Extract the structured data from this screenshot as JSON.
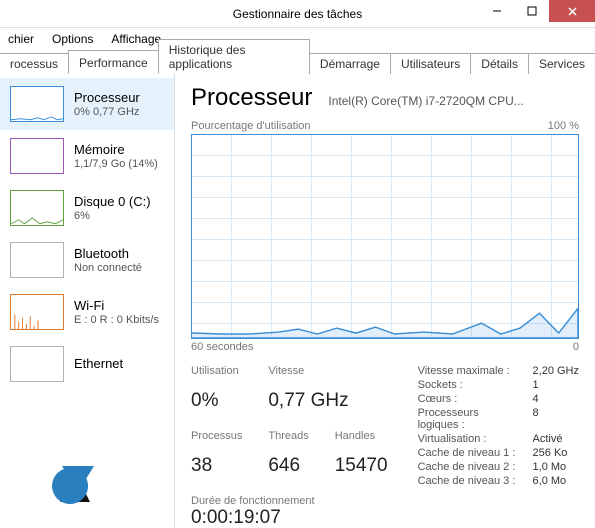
{
  "window": {
    "title": "Gestionnaire des tâches"
  },
  "menu": {
    "file": "chier",
    "options": "Options",
    "view": "Affichage"
  },
  "tabs": {
    "processes": "rocessus",
    "performance": "Performance",
    "apphistory": "Historique des applications",
    "startup": "Démarrage",
    "users": "Utilisateurs",
    "details": "Détails",
    "services": "Services"
  },
  "sidebar": {
    "cpu": {
      "title": "Processeur",
      "sub": "0%  0,77 GHz"
    },
    "mem": {
      "title": "Mémoire",
      "sub": "1,1/7,9 Go (14%)"
    },
    "disk": {
      "title": "Disque 0 (C:)",
      "sub": "6%"
    },
    "bt": {
      "title": "Bluetooth",
      "sub": "Non connecté"
    },
    "wifi": {
      "title": "Wi-Fi",
      "sub": "E : 0 R : 0 Kbits/s"
    },
    "eth": {
      "title": "Ethernet",
      "sub": ""
    }
  },
  "main": {
    "title": "Processeur",
    "subtitle": "Intel(R) Core(TM) i7-2720QM CPU...",
    "chart_label": "Pourcentage d'utilisation",
    "chart_max": "100 %",
    "chart_xmin": "60 secondes",
    "chart_xmax": "0",
    "stats": {
      "util_label": "Utilisation",
      "util": "0%",
      "speed_label": "Vitesse",
      "speed": "0,77 GHz",
      "proc_label": "Processus",
      "proc": "38",
      "threads_label": "Threads",
      "threads": "646",
      "handles_label": "Handles",
      "handles": "15470",
      "uptime_label": "Durée de fonctionnement",
      "uptime": "0:00:19:07"
    },
    "details": {
      "maxspeed_label": "Vitesse maximale :",
      "maxspeed": "2,20 GHz",
      "sockets_label": "Sockets :",
      "sockets": "1",
      "cores_label": "Cœurs :",
      "cores": "4",
      "logical_label": "Processeurs logiques :",
      "logical": "8",
      "virt_label": "Virtualisation :",
      "virt": "Activé",
      "l1_label": "Cache de niveau 1 :",
      "l1": "256 Ko",
      "l2_label": "Cache de niveau 2 :",
      "l2": "1,0 Mo",
      "l3_label": "Cache de niveau 3 :",
      "l3": "6,0 Mo"
    }
  },
  "chart_data": {
    "type": "line",
    "title": "Pourcentage d'utilisation",
    "xlabel": "60 secondes → 0",
    "ylabel": "%",
    "ylim": [
      0,
      100
    ],
    "x": [
      0,
      5,
      10,
      15,
      20,
      25,
      30,
      35,
      40,
      45,
      50,
      55,
      60
    ],
    "values": [
      3,
      2,
      2,
      5,
      4,
      3,
      6,
      3,
      2,
      4,
      10,
      4,
      14
    ]
  }
}
